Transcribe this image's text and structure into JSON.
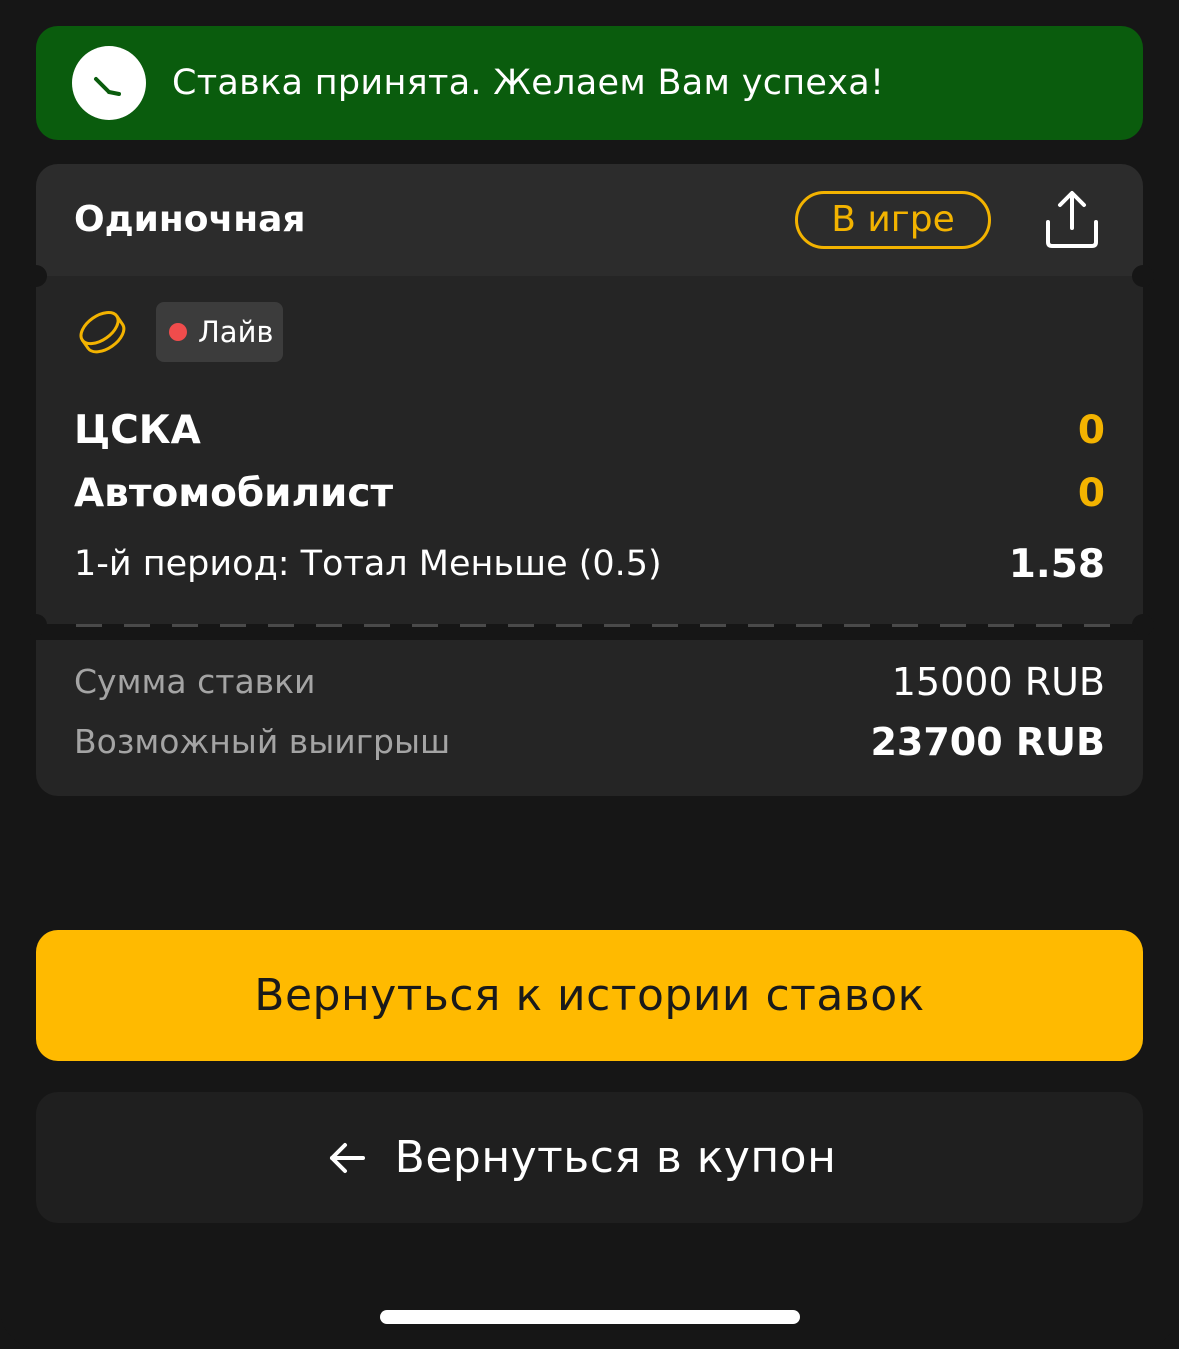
{
  "toast": {
    "message": "Ставка принята. Желаем Вам успеха!",
    "icon": "clock-icon",
    "bg_color": "#0a5c0d"
  },
  "bet": {
    "type_label": "Одиночная",
    "status_label": "В игре",
    "share_icon": "share-icon",
    "sport_icon": "hockey-puck-icon",
    "live_label": "Лайв",
    "teams": [
      {
        "name": "ЦСКА",
        "score": "0"
      },
      {
        "name": "Автомобилист",
        "score": "0"
      }
    ],
    "market": "1-й период: Тотал Меньше (0.5)",
    "odds": "1.58",
    "stake_label": "Сумма ставки",
    "stake_value": "15000 RUB",
    "win_label": "Возможный выигрыш",
    "win_value": "23700 RUB"
  },
  "actions": {
    "history_label": "Вернуться к истории ставок",
    "coupon_label": "Вернуться в купон",
    "coupon_icon": "arrow-left-icon"
  },
  "colors": {
    "accent": "#ffba00",
    "status": "#f3b300",
    "live_dot": "#f04c4c",
    "background": "#161616"
  }
}
